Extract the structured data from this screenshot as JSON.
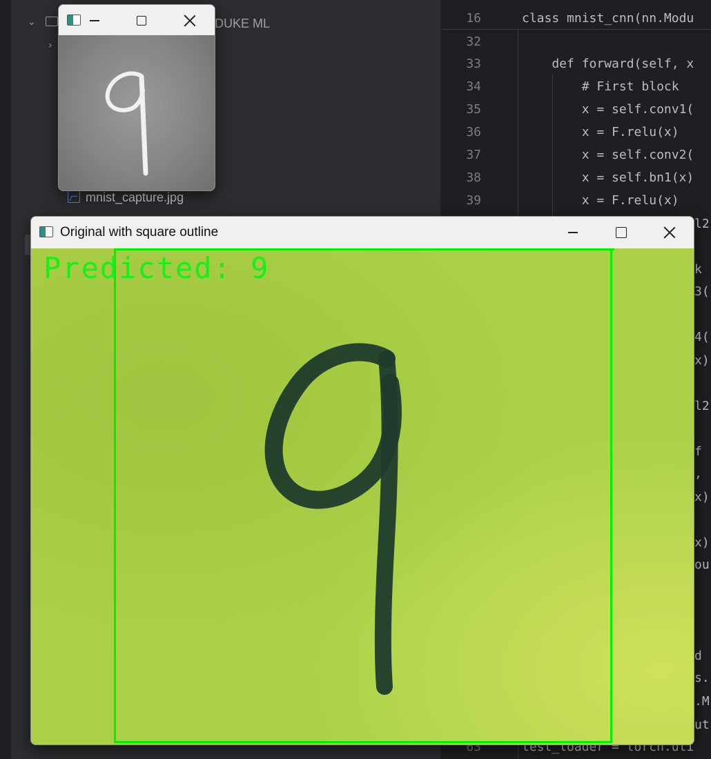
{
  "project_panel": {
    "path_label": "r\\DUKE ML",
    "file_label": "mnist_capture.jpg"
  },
  "editor": {
    "lines": [
      {
        "num": "16",
        "text": "class mnist_cnn(nn.Modu"
      },
      {
        "num": "32",
        "text": ""
      },
      {
        "num": "33",
        "text": "    def forward(self, x"
      },
      {
        "num": "34",
        "text": "        # First block"
      },
      {
        "num": "35",
        "text": "        x = self.conv1("
      },
      {
        "num": "36",
        "text": "        x = F.relu(x)"
      },
      {
        "num": "37",
        "text": "        x = self.conv2("
      },
      {
        "num": "38",
        "text": "        x = self.bn1(x)"
      },
      {
        "num": "39",
        "text": "        x = F.relu(x)"
      },
      {
        "num": "63",
        "text": "test_loader = torch.uti"
      }
    ],
    "edge_fragments": [
      "l2",
      "k",
      "3(",
      "4(",
      "x)",
      "l2",
      "f",
      ",",
      "x)",
      "x)",
      "ou",
      "d",
      "s.",
      ".M",
      "ut"
    ]
  },
  "mnist_window": {
    "title": "",
    "digit": "9"
  },
  "capture_window": {
    "title": "Original with square outline",
    "prediction": "Predicted: 9",
    "digit": "9"
  },
  "colors": {
    "outline": "#00f000",
    "prediction_text": "#18ee18",
    "paper_green": "#acd149",
    "ink": "#1f3b2c"
  },
  "icons": [
    "chevron-down-icon",
    "chevron-right-icon",
    "folder-icon",
    "image-file-icon",
    "app-icon",
    "minimize-icon",
    "maximize-icon",
    "close-icon"
  ]
}
